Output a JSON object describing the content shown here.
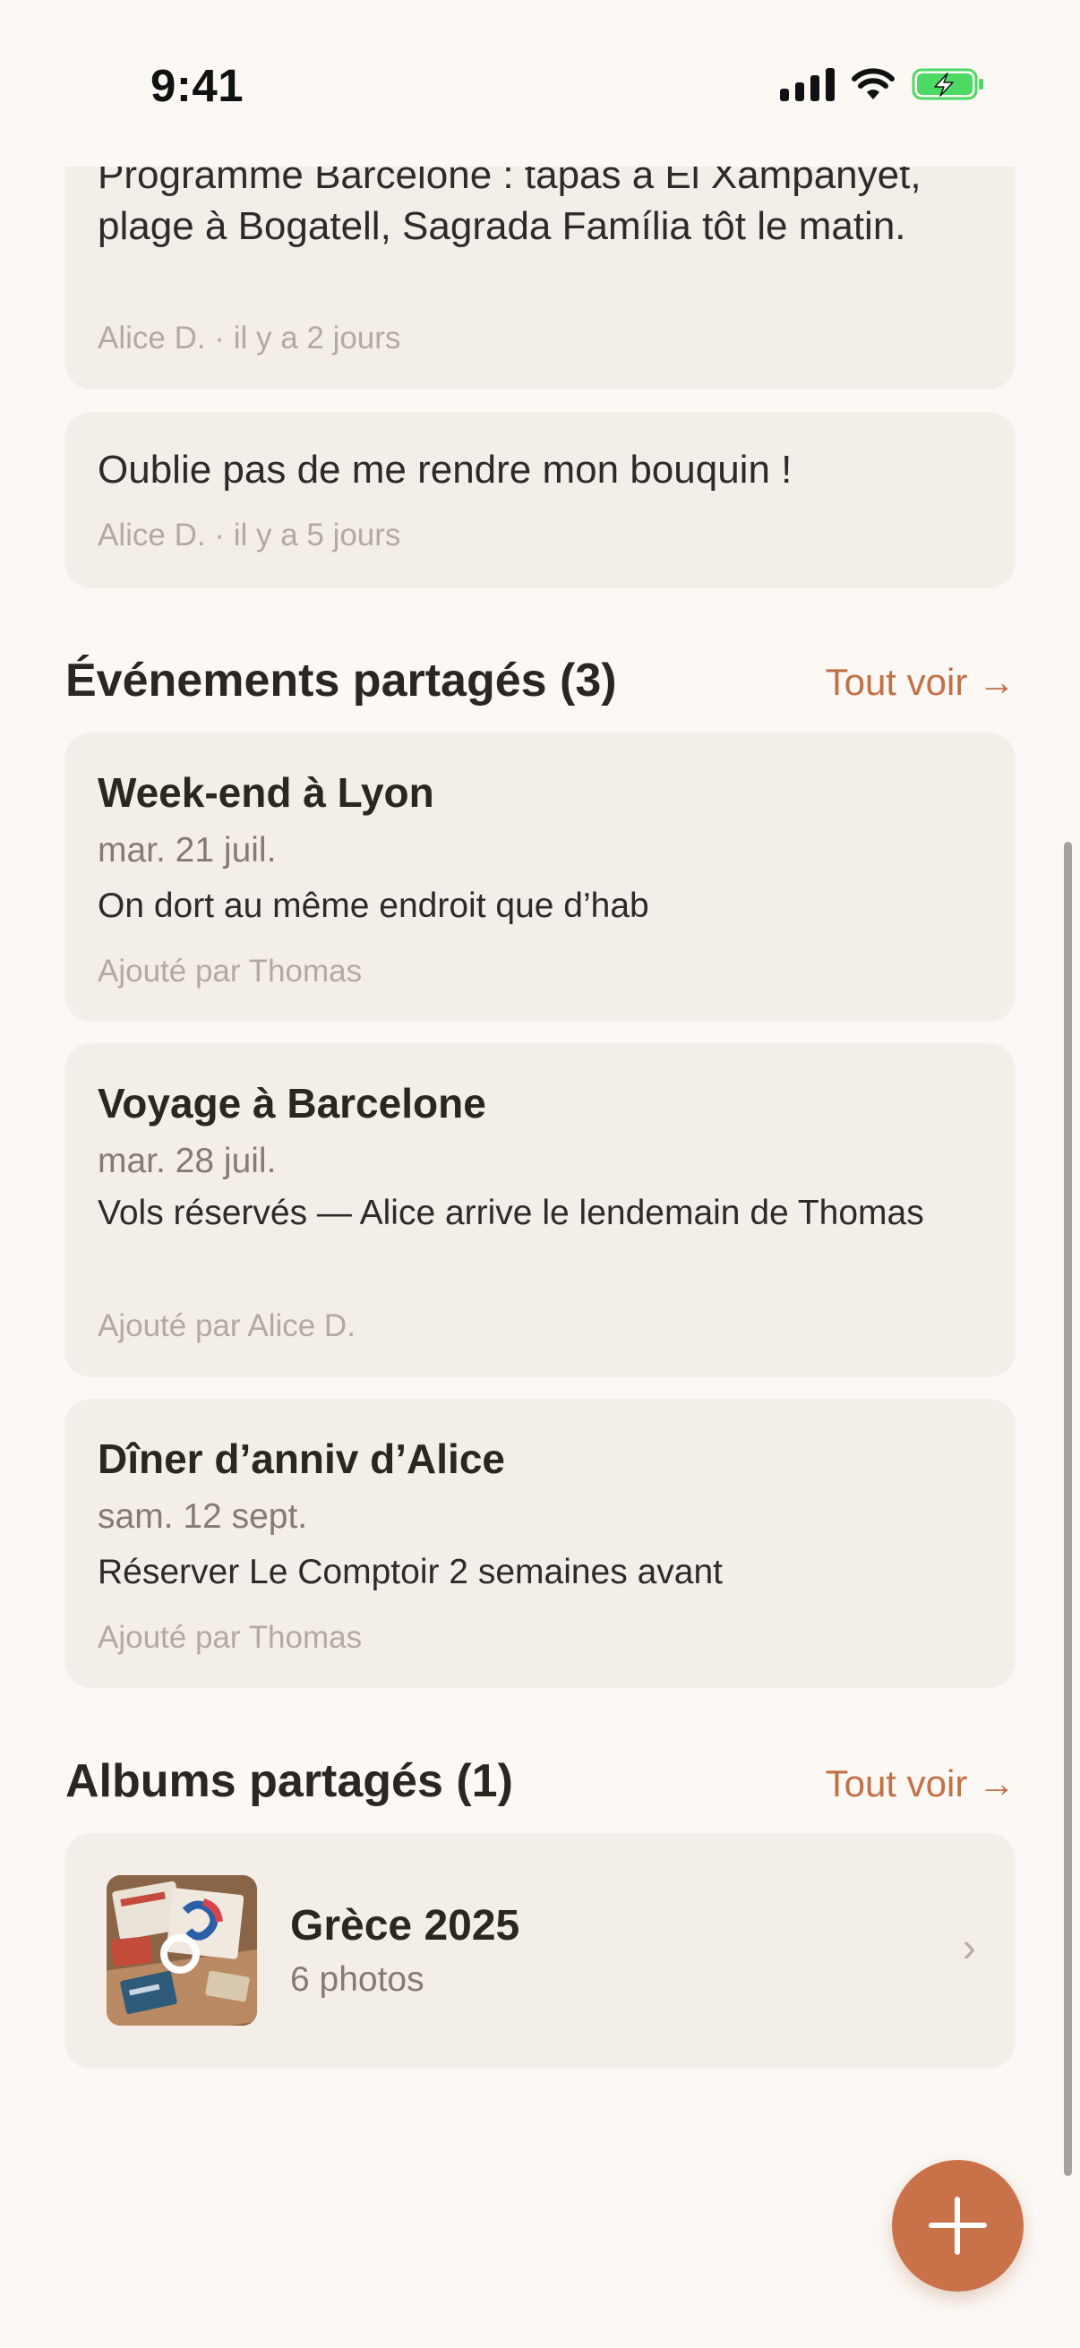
{
  "status_bar": {
    "time": "9:41"
  },
  "notes": [
    {
      "text": "Programme Barcelone : tapas à El Xampanyet, plage à Bogatell, Sagrada Família tôt le matin.",
      "meta": "Alice D. · il y a 2 jours"
    },
    {
      "text": "Oublie pas de me rendre mon bouquin !",
      "meta": "Alice D. · il y a 5 jours"
    }
  ],
  "events_section": {
    "title": "Événements partagés (3)",
    "see_all": "Tout voir →",
    "items": [
      {
        "title": "Week-end à Lyon",
        "date": "mar. 21 juil.",
        "description": "On dort au même endroit que d’hab",
        "added_by": "Ajouté par Thomas"
      },
      {
        "title": "Voyage à Barcelone",
        "date": "mar. 28 juil.",
        "description": "Vols réservés — Alice arrive le lendemain de Thomas",
        "added_by": "Ajouté par Alice D."
      },
      {
        "title": "Dîner d’anniv d’Alice",
        "date": "sam. 12 sept.",
        "description": "Réserver Le Comptoir 2 semaines avant",
        "added_by": "Ajouté par Thomas"
      }
    ]
  },
  "albums_section": {
    "title": "Albums partagés (1)",
    "see_all": "Tout voir →",
    "items": [
      {
        "title": "Grèce 2025",
        "count": "6 photos",
        "chevron": "›"
      }
    ]
  },
  "fab": {
    "icon": "plus-icon"
  },
  "colors": {
    "background": "#fcf9f5",
    "card": "#f3efe8",
    "accent": "#c27048",
    "fab": "#c97249",
    "battery_charging": "#4cd964"
  }
}
